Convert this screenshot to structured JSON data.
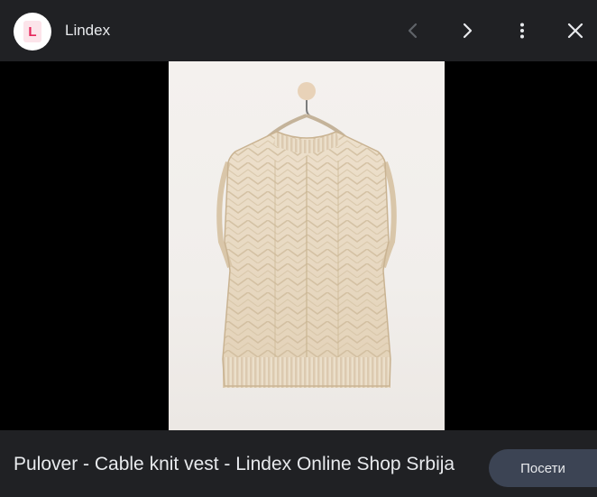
{
  "header": {
    "logo_letter": "L",
    "site_name": "Lindex",
    "icons": [
      "chevron-left-icon",
      "chevron-right-icon",
      "more-vert-icon",
      "close-icon"
    ]
  },
  "image": {
    "subject": "sweater-vest"
  },
  "footer": {
    "caption": "Pulover - Cable knit vest - Lindex Online Shop Srbija",
    "visit_label": "Посети"
  },
  "colors": {
    "header_bg": "#202124",
    "background": "#000000",
    "text": "#e8eaed",
    "visit_button_bg": "#3c4454",
    "logo_accent": "#e5265b"
  }
}
